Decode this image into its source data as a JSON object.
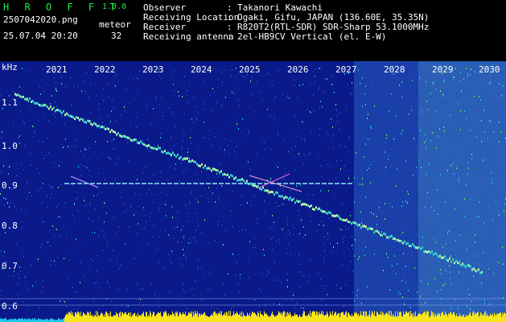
{
  "header": {
    "app_name": "H R O F F T",
    "version": "1.0.0",
    "filename": "2507042020.png",
    "meteor_label": "meteor",
    "datetime": "25.07.04 20:20",
    "meteor_count": "32",
    "info": [
      {
        "key": "Observer",
        "sep": ":",
        "value": "Takanori Kawachi"
      },
      {
        "key": "Receiving Location",
        "sep": ":",
        "value": "Ogaki, Gifu, JAPAN (136.60E, 35.35N)"
      },
      {
        "key": "Receiver",
        "sep": ":",
        "value": "R820T2(RTL-SDR) SDR-Sharp 53.1000MHz"
      },
      {
        "key": "Receiving antenna",
        "sep": ":",
        "value": "2el-HB9CV Vertical (el. E-W)"
      }
    ]
  },
  "plot": {
    "unit_label": "kHz",
    "y_ticks": [
      "1.1",
      "1.0",
      "0.9",
      "0.8",
      "0.7",
      "0.6"
    ],
    "x_ticks": [
      "2021",
      "2022",
      "2023",
      "2024",
      "2025",
      "2026",
      "2027",
      "2028",
      "2029",
      "2030"
    ]
  }
}
